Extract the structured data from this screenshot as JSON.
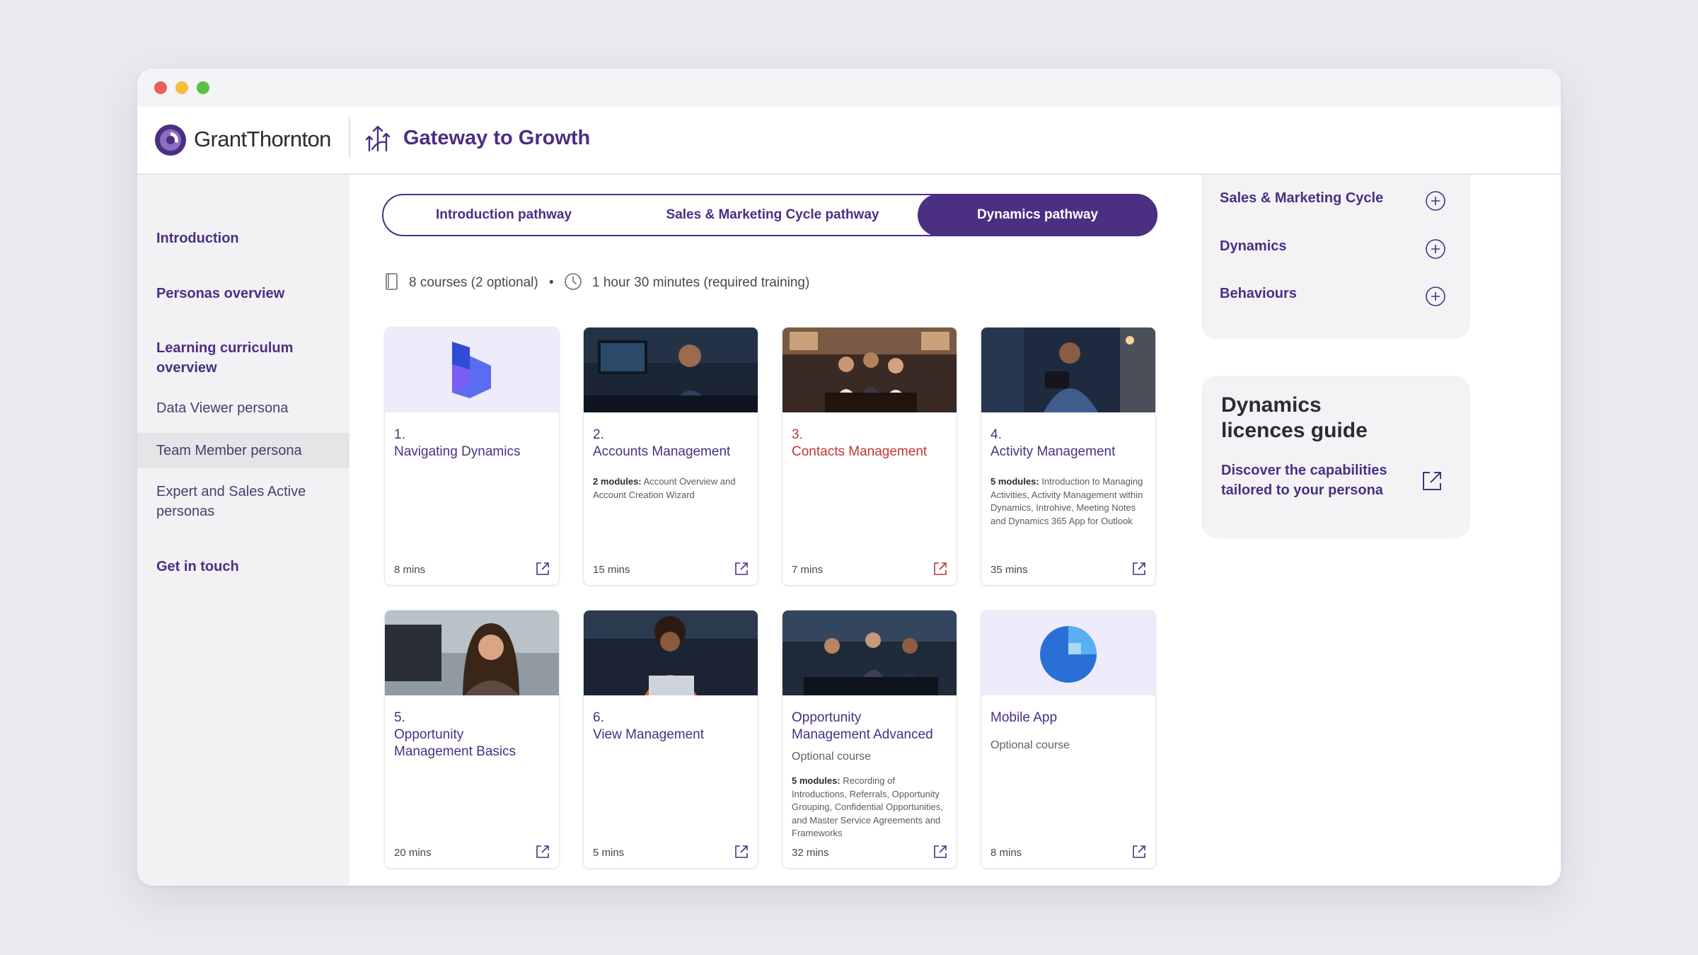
{
  "brand": {
    "company": "GrantThornton",
    "app_title": "Gateway to Growth",
    "accent": "#4b2f82",
    "highlight_red": "#c23434"
  },
  "sidebar": {
    "items": [
      {
        "label": "Introduction"
      },
      {
        "label": "Personas overview"
      },
      {
        "label": "Learning curriculum overview"
      },
      {
        "label": "Data Viewer persona"
      },
      {
        "label": "Team Member persona",
        "active": true
      },
      {
        "label": "Expert and Sales Active personas"
      },
      {
        "label": "Get in touch"
      }
    ]
  },
  "tabs": [
    {
      "label": "Introduction pathway"
    },
    {
      "label": "Sales & Marketing Cycle pathway"
    },
    {
      "label": "Dynamics pathway",
      "active": true
    }
  ],
  "meta": {
    "courses": "8 courses (2 optional)",
    "separator": "•",
    "duration": "1 hour 30 minutes (required training)",
    "course_icon": "book-icon",
    "time_icon": "clock-icon"
  },
  "cards": [
    {
      "title": "1.\nNavigating Dynamics",
      "optional": "",
      "modules_bold": "",
      "modules_text": "",
      "mins": "8 mins",
      "image": "dynamics-logo"
    },
    {
      "title": "2.\nAccounts Management",
      "optional": "",
      "modules_bold": "2 modules:",
      "modules_text": " Account Overview and Account Creation Wizard",
      "mins": "15 mins",
      "image": "photo-man-at-computer"
    },
    {
      "title": "3.\nContacts Management",
      "optional": "",
      "modules_bold": "",
      "modules_text": "",
      "mins": "7 mins",
      "image": "photo-team-meeting",
      "highlight": true
    },
    {
      "title": "4.\nActivity Management",
      "optional": "",
      "modules_bold": "5 modules:",
      "modules_text": " Introduction to Managing Activities, Activity Management within Dynamics, Introhive, Meeting Notes and Dynamics 365 App for Outlook",
      "mins": "35 mins",
      "image": "photo-man-with-tablet"
    },
    {
      "title": "5.\nOpportunity\nManagement Basics",
      "optional": "",
      "modules_bold": "",
      "modules_text": "",
      "mins": "20 mins",
      "image": "photo-woman-smiling"
    },
    {
      "title": "6.\nView Management",
      "optional": "",
      "modules_bold": "",
      "modules_text": "",
      "mins": "5 mins",
      "image": "photo-woman-with-laptop"
    },
    {
      "title": "Opportunity\nManagement Advanced",
      "optional": "Optional course",
      "modules_bold": "5 modules:",
      "modules_text": " Recording of Introductions, Referrals, Opportunity Grouping, Confidential Opportunities, and Master Service Agreements and Frameworks",
      "mins": "32 mins",
      "image": "photo-group-at-table"
    },
    {
      "title": "Mobile App",
      "optional": "Optional course",
      "modules_bold": "",
      "modules_text": "",
      "mins": "8 mins",
      "image": "mobile-app-logo"
    }
  ],
  "accordion": [
    {
      "label": "Sales & Marketing Cycle",
      "icon": "plus-circle-icon"
    },
    {
      "label": "Dynamics",
      "icon": "plus-circle-icon"
    },
    {
      "label": "Behaviours",
      "icon": "plus-circle-icon"
    }
  ],
  "guide": {
    "title": "Dynamics licences guide",
    "link": "Discover the capabilities tailored to your persona",
    "icon": "external-link-icon"
  }
}
